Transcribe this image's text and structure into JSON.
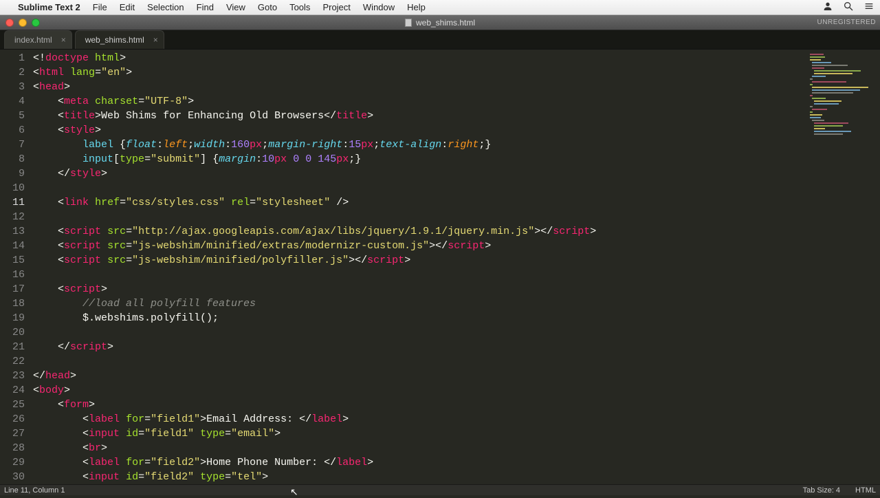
{
  "menubar": {
    "app": "Sublime Text 2",
    "items": [
      "File",
      "Edit",
      "Selection",
      "Find",
      "View",
      "Goto",
      "Tools",
      "Project",
      "Window",
      "Help"
    ]
  },
  "window": {
    "title": "web_shims.html",
    "unregistered": "UNREGISTERED"
  },
  "tabs": [
    {
      "label": "index.html",
      "active": false
    },
    {
      "label": "web_shims.html",
      "active": true
    }
  ],
  "status": {
    "left": "Line 11, Column 1",
    "tabsize": "Tab Size: 4",
    "syntax": "HTML"
  },
  "editor": {
    "current_line": 11,
    "lines": [
      {
        "n": 1,
        "t": [
          [
            "p",
            "<!"
          ],
          [
            "tg",
            "doctype"
          ],
          [
            "p",
            " "
          ],
          [
            "an",
            "html"
          ],
          [
            "p",
            ">"
          ]
        ]
      },
      {
        "n": 2,
        "t": [
          [
            "p",
            "<"
          ],
          [
            "tg",
            "html"
          ],
          [
            "p",
            " "
          ],
          [
            "an",
            "lang"
          ],
          [
            "p",
            "="
          ],
          [
            "st",
            "\"en\""
          ],
          [
            "p",
            ">"
          ]
        ]
      },
      {
        "n": 3,
        "t": [
          [
            "p",
            "<"
          ],
          [
            "tg",
            "head"
          ],
          [
            "p",
            ">"
          ]
        ]
      },
      {
        "n": 4,
        "indent": 1,
        "t": [
          [
            "p",
            "<"
          ],
          [
            "tg",
            "meta"
          ],
          [
            "p",
            " "
          ],
          [
            "an",
            "charset"
          ],
          [
            "p",
            "="
          ],
          [
            "st",
            "\"UTF-8\""
          ],
          [
            "p",
            ">"
          ]
        ]
      },
      {
        "n": 5,
        "indent": 1,
        "t": [
          [
            "p",
            "<"
          ],
          [
            "tg",
            "title"
          ],
          [
            "p",
            ">Web Shims for Enhancing Old Browsers</"
          ],
          [
            "tg",
            "title"
          ],
          [
            "p",
            ">"
          ]
        ]
      },
      {
        "n": 6,
        "indent": 1,
        "t": [
          [
            "p",
            "<"
          ],
          [
            "tg",
            "style"
          ],
          [
            "p",
            ">"
          ]
        ]
      },
      {
        "n": 7,
        "indent": 2,
        "t": [
          [
            "sel",
            "label"
          ],
          [
            "p",
            " {"
          ],
          [
            "kw",
            "float"
          ],
          [
            "p",
            ":"
          ],
          [
            "va",
            "left"
          ],
          [
            "p",
            ";"
          ],
          [
            "kw",
            "width"
          ],
          [
            "p",
            ":"
          ],
          [
            "nm",
            "160"
          ],
          [
            "tg",
            "px"
          ],
          [
            "p",
            ";"
          ],
          [
            "kw",
            "margin-right"
          ],
          [
            "p",
            ":"
          ],
          [
            "nm",
            "15"
          ],
          [
            "tg",
            "px"
          ],
          [
            "p",
            ";"
          ],
          [
            "kw",
            "text-align"
          ],
          [
            "p",
            ":"
          ],
          [
            "va",
            "right"
          ],
          [
            "p",
            ";}"
          ]
        ]
      },
      {
        "n": 8,
        "indent": 2,
        "t": [
          [
            "sel",
            "input"
          ],
          [
            "p",
            "["
          ],
          [
            "an",
            "type"
          ],
          [
            "p",
            "="
          ],
          [
            "st",
            "\"submit\""
          ],
          [
            "p",
            "] {"
          ],
          [
            "kw",
            "margin"
          ],
          [
            "p",
            ":"
          ],
          [
            "nm",
            "10"
          ],
          [
            "tg",
            "px"
          ],
          [
            "p",
            " "
          ],
          [
            "nm",
            "0"
          ],
          [
            "p",
            " "
          ],
          [
            "nm",
            "0"
          ],
          [
            "p",
            " "
          ],
          [
            "nm",
            "145"
          ],
          [
            "tg",
            "px"
          ],
          [
            "p",
            ";}"
          ]
        ]
      },
      {
        "n": 9,
        "indent": 1,
        "t": [
          [
            "p",
            "</"
          ],
          [
            "tg",
            "style"
          ],
          [
            "p",
            ">"
          ]
        ]
      },
      {
        "n": 10,
        "t": []
      },
      {
        "n": 11,
        "indent": 1,
        "t": [
          [
            "p",
            "<"
          ],
          [
            "tg",
            "link"
          ],
          [
            "p",
            " "
          ],
          [
            "an",
            "href"
          ],
          [
            "p",
            "="
          ],
          [
            "st",
            "\"css/styles.css\""
          ],
          [
            "p",
            " "
          ],
          [
            "an",
            "rel"
          ],
          [
            "p",
            "="
          ],
          [
            "st",
            "\"stylesheet\""
          ],
          [
            "p",
            " />"
          ]
        ]
      },
      {
        "n": 12,
        "t": []
      },
      {
        "n": 13,
        "indent": 1,
        "t": [
          [
            "p",
            "<"
          ],
          [
            "tg",
            "script"
          ],
          [
            "p",
            " "
          ],
          [
            "an",
            "src"
          ],
          [
            "p",
            "="
          ],
          [
            "st",
            "\"http://ajax.googleapis.com/ajax/libs/jquery/1.9.1/jquery.min.js\""
          ],
          [
            "p",
            "></"
          ],
          [
            "tg",
            "script"
          ],
          [
            "p",
            ">"
          ]
        ]
      },
      {
        "n": 14,
        "indent": 1,
        "t": [
          [
            "p",
            "<"
          ],
          [
            "tg",
            "script"
          ],
          [
            "p",
            " "
          ],
          [
            "an",
            "src"
          ],
          [
            "p",
            "="
          ],
          [
            "st",
            "\"js-webshim/minified/extras/modernizr-custom.js\""
          ],
          [
            "p",
            "></"
          ],
          [
            "tg",
            "script"
          ],
          [
            "p",
            ">"
          ]
        ]
      },
      {
        "n": 15,
        "indent": 1,
        "t": [
          [
            "p",
            "<"
          ],
          [
            "tg",
            "script"
          ],
          [
            "p",
            " "
          ],
          [
            "an",
            "src"
          ],
          [
            "p",
            "="
          ],
          [
            "st",
            "\"js-webshim/minified/polyfiller.js\""
          ],
          [
            "p",
            "></"
          ],
          [
            "tg",
            "script"
          ],
          [
            "p",
            ">"
          ]
        ]
      },
      {
        "n": 16,
        "t": []
      },
      {
        "n": 17,
        "indent": 1,
        "t": [
          [
            "p",
            "<"
          ],
          [
            "tg",
            "script"
          ],
          [
            "p",
            ">"
          ]
        ]
      },
      {
        "n": 18,
        "indent": 2,
        "t": [
          [
            "cm",
            "//load all polyfill features"
          ]
        ]
      },
      {
        "n": 19,
        "indent": 2,
        "t": [
          [
            "p",
            "$.webshims.polyfill();"
          ]
        ]
      },
      {
        "n": 20,
        "t": []
      },
      {
        "n": 21,
        "indent": 1,
        "t": [
          [
            "p",
            "</"
          ],
          [
            "tg",
            "script"
          ],
          [
            "p",
            ">"
          ]
        ]
      },
      {
        "n": 22,
        "t": []
      },
      {
        "n": 23,
        "t": [
          [
            "p",
            "</"
          ],
          [
            "tg",
            "head"
          ],
          [
            "p",
            ">"
          ]
        ]
      },
      {
        "n": 24,
        "t": [
          [
            "p",
            "<"
          ],
          [
            "tg",
            "body"
          ],
          [
            "p",
            ">"
          ]
        ]
      },
      {
        "n": 25,
        "indent": 1,
        "t": [
          [
            "p",
            "<"
          ],
          [
            "tg",
            "form"
          ],
          [
            "p",
            ">"
          ]
        ]
      },
      {
        "n": 26,
        "indent": 2,
        "t": [
          [
            "p",
            "<"
          ],
          [
            "tg",
            "label"
          ],
          [
            "p",
            " "
          ],
          [
            "an",
            "for"
          ],
          [
            "p",
            "="
          ],
          [
            "st",
            "\"field1\""
          ],
          [
            "p",
            ">Email Address: </"
          ],
          [
            "tg",
            "label"
          ],
          [
            "p",
            ">"
          ]
        ]
      },
      {
        "n": 27,
        "indent": 2,
        "t": [
          [
            "p",
            "<"
          ],
          [
            "tg",
            "input"
          ],
          [
            "p",
            " "
          ],
          [
            "an",
            "id"
          ],
          [
            "p",
            "="
          ],
          [
            "st",
            "\"field1\""
          ],
          [
            "p",
            " "
          ],
          [
            "an",
            "type"
          ],
          [
            "p",
            "="
          ],
          [
            "st",
            "\"email\""
          ],
          [
            "p",
            ">"
          ]
        ]
      },
      {
        "n": 28,
        "indent": 2,
        "t": [
          [
            "p",
            "<"
          ],
          [
            "tg",
            "br"
          ],
          [
            "p",
            ">"
          ]
        ]
      },
      {
        "n": 29,
        "indent": 2,
        "t": [
          [
            "p",
            "<"
          ],
          [
            "tg",
            "label"
          ],
          [
            "p",
            " "
          ],
          [
            "an",
            "for"
          ],
          [
            "p",
            "="
          ],
          [
            "st",
            "\"field2\""
          ],
          [
            "p",
            ">Home Phone Number: </"
          ],
          [
            "tg",
            "label"
          ],
          [
            "p",
            ">"
          ]
        ]
      },
      {
        "n": 30,
        "indent": 2,
        "t": [
          [
            "p",
            "<"
          ],
          [
            "tg",
            "input"
          ],
          [
            "p",
            " "
          ],
          [
            "an",
            "id"
          ],
          [
            "p",
            "="
          ],
          [
            "st",
            "\"field2\""
          ],
          [
            "p",
            " "
          ],
          [
            "an",
            "type"
          ],
          [
            "p",
            "="
          ],
          [
            "st",
            "\"tel\""
          ],
          [
            "p",
            ">"
          ]
        ]
      }
    ]
  }
}
